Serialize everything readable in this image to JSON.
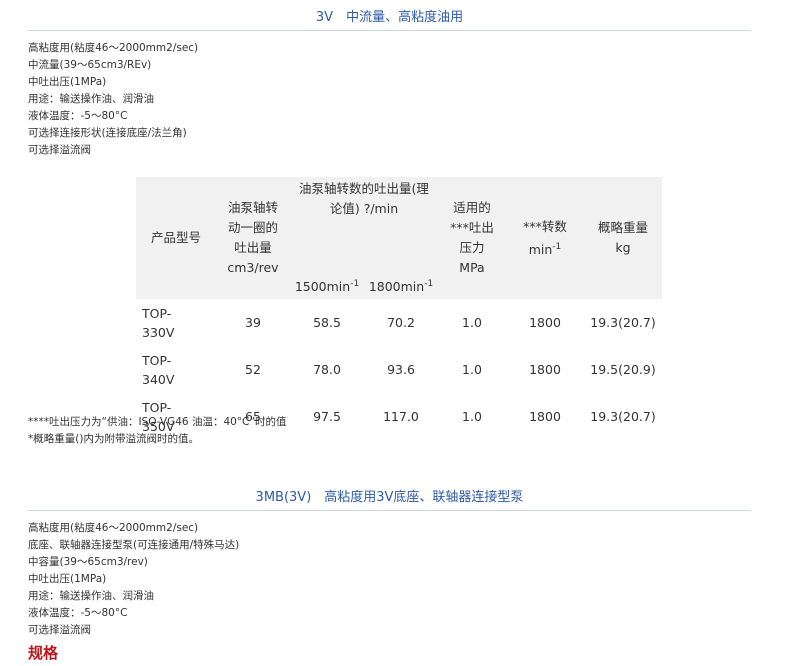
{
  "section1": {
    "title": "3V　中流量、高粘度油用",
    "specs": [
      "高粘度用(粘度46～2000mm2/sec)",
      "中流量(39～65cm3/REv)",
      "中吐出压(1MPa)",
      "用途：输送操作油、润滑油",
      "液体温度：-5～80°C",
      "可选择连接形状(连接底座/法兰角)",
      "可选择溢流阀"
    ],
    "table": {
      "headers": {
        "model": "产品型号",
        "displacement": "油泵轴转动一圈的吐出量cm3/rev",
        "flow_group": "油泵轴转数的吐出量(理论值) ?/min",
        "flow_1500": "1500min",
        "flow_1800": "1800min",
        "sup": "-1",
        "pressure": "适用的***吐出压力MPa",
        "speed": "***转数min",
        "weight": "概略重量kg"
      },
      "rows": [
        {
          "model": "TOP-330V",
          "displacement": "39",
          "flow_1500": "58.5",
          "flow_1800": "70.2",
          "pressure": "1.0",
          "speed": "1800",
          "weight": "19.3(20.7)"
        },
        {
          "model": "TOP-340V",
          "displacement": "52",
          "flow_1500": "78.0",
          "flow_1800": "93.6",
          "pressure": "1.0",
          "speed": "1800",
          "weight": "19.5(20.9)"
        },
        {
          "model": "TOP-350V",
          "displacement": "65",
          "flow_1500": "97.5",
          "flow_1800": "117.0",
          "pressure": "1.0",
          "speed": "1800",
          "weight": "19.3(20.7)"
        }
      ]
    },
    "notes": [
      "****吐出压力为“供油：ISO-VG46 油温：40°C”时的值",
      "*概略重量()内为附带溢流阀时的值。"
    ]
  },
  "section2": {
    "title": "3MB(3V)　高粘度用3V底座、联轴器连接型泵",
    "specs": [
      "高粘度用(粘度46～2000mm2/sec)",
      "底座、联轴器连接型泵(可连接通用/特殊马达)",
      "中容量(39～65cm3/rev)",
      "中吐出压(1MPa)",
      "用途：输送操作油、润滑油",
      "液体温度：-5～80°C",
      "可选择溢流阀"
    ],
    "spec_heading": "规格"
  }
}
